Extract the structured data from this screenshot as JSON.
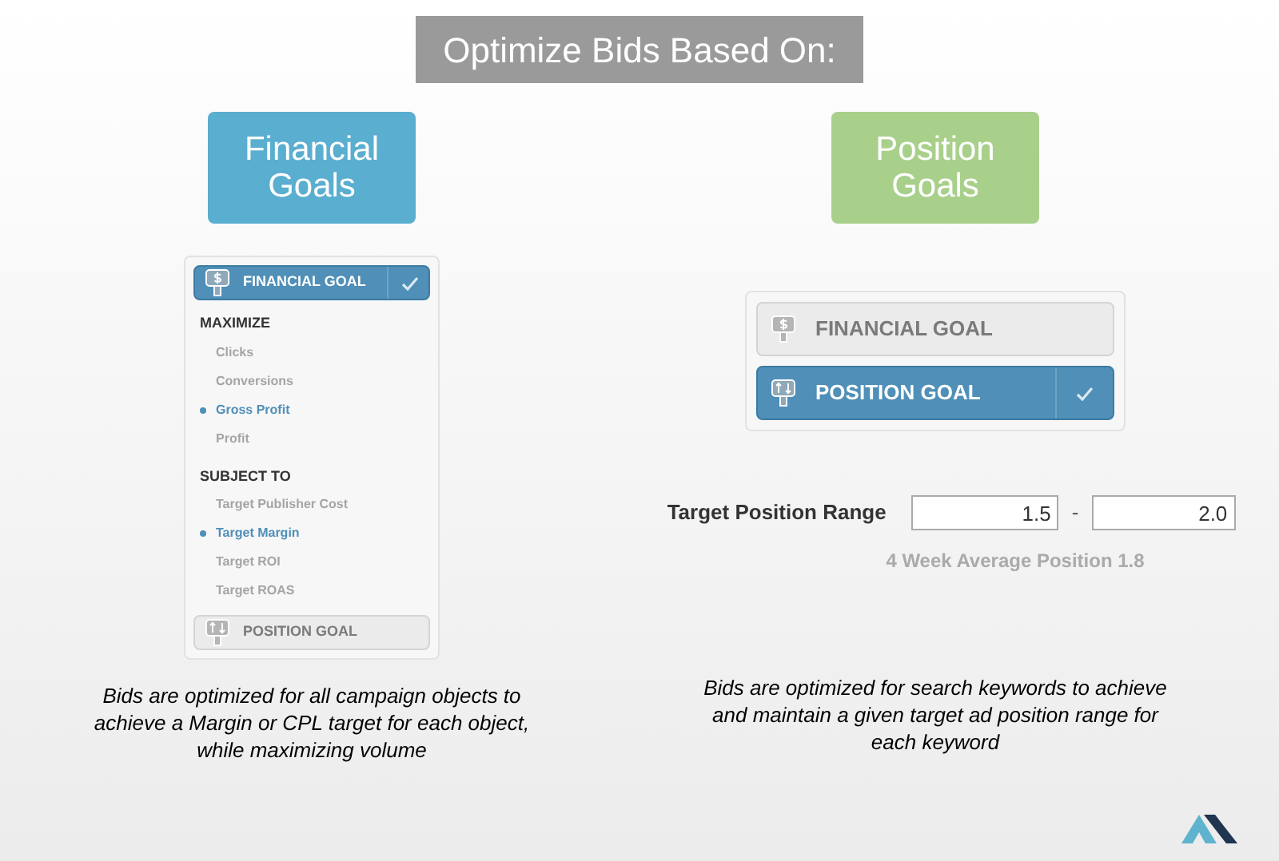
{
  "title": "Optimize Bids Based On:",
  "left": {
    "heading": "Financial Goals",
    "panel": {
      "goals": [
        {
          "label": "FINANCIAL GOAL",
          "selected": true,
          "kind": "financial"
        }
      ],
      "sections": [
        {
          "label": "MAXIMIZE",
          "options": [
            {
              "label": "Clicks",
              "selected": false
            },
            {
              "label": "Conversions",
              "selected": false
            },
            {
              "label": "Gross Profit",
              "selected": true
            },
            {
              "label": "Profit",
              "selected": false
            }
          ]
        },
        {
          "label": "SUBJECT TO",
          "options": [
            {
              "label": "Target Publisher Cost",
              "selected": false
            },
            {
              "label": "Target Margin",
              "selected": true
            },
            {
              "label": "Target ROI",
              "selected": false
            },
            {
              "label": "Target ROAS",
              "selected": false
            }
          ]
        }
      ],
      "bottom_goal": {
        "label": "POSITION GOAL",
        "selected": false,
        "kind": "position"
      }
    },
    "caption": "Bids are optimized for all campaign objects to achieve a Margin or CPL target for each object, while maximizing volume"
  },
  "right": {
    "heading": "Position Goals",
    "goals": [
      {
        "label": "FINANCIAL GOAL",
        "selected": false,
        "kind": "financial"
      },
      {
        "label": "POSITION GOAL",
        "selected": true,
        "kind": "position"
      }
    ],
    "range": {
      "label": "Target Position Range",
      "from": "1.5",
      "separator": "-",
      "to": "2.0",
      "note": "4 Week Average Position 1.8"
    },
    "caption": "Bids are optimized for search keywords to achieve and maintain a given target ad position range for each keyword"
  }
}
